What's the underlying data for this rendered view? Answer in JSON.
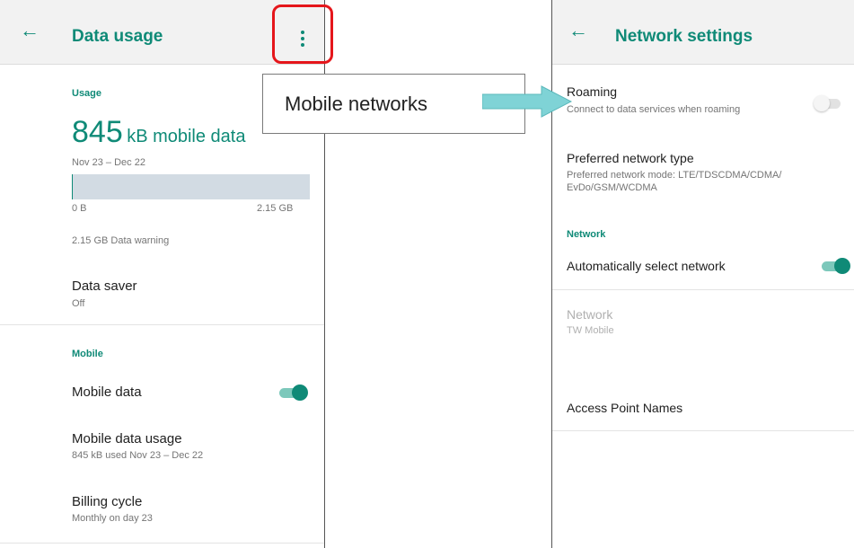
{
  "left_screen": {
    "title": "Data usage",
    "usage_header": "Usage",
    "usage_amount": "845",
    "usage_unit": "kB mobile data",
    "date_range": "Nov 23 – Dec 22",
    "usage_fraction": 0.0004,
    "bar_min": "0 B",
    "bar_max": "2.15 GB",
    "data_warning": "2.15 GB Data warning",
    "data_saver": {
      "title": "Data saver",
      "value": "Off"
    },
    "mobile_header": "Mobile",
    "mobile_data": {
      "title": "Mobile data",
      "enabled": true
    },
    "mobile_data_usage": {
      "title": "Mobile data usage",
      "summary": "845 kB used Nov 23 – Dec 22"
    },
    "billing_cycle": {
      "title": "Billing cycle",
      "summary": "Monthly on day 23"
    }
  },
  "callout": {
    "text": "Mobile networks"
  },
  "right_screen": {
    "title": "Network settings",
    "roaming": {
      "title": "Roaming",
      "summary": "Connect to data services when roaming",
      "enabled": false
    },
    "preferred_network": {
      "title": "Preferred network type",
      "summary_line1": "Preferred network mode: LTE/TDSCDMA/CDMA/",
      "summary_line2": "EvDo/GSM/WCDMA"
    },
    "network_header": "Network",
    "auto_select": {
      "title": "Automatically select network",
      "enabled": true
    },
    "network": {
      "title": "Network",
      "value": "TW Mobile"
    },
    "apn": {
      "title": "Access Point Names"
    }
  },
  "colors": {
    "accent": "#0f8a77",
    "highlight": "#e5161b",
    "arrow": "#7fd3d6"
  }
}
